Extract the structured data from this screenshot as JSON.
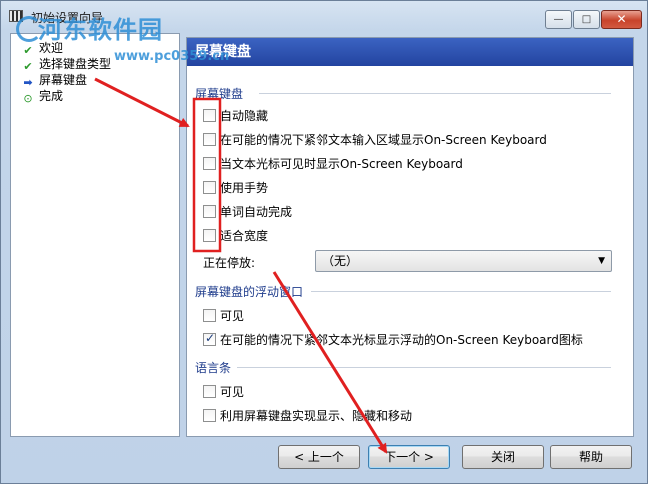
{
  "window": {
    "title": "初始设置向导",
    "controls": {
      "minimize": "—",
      "maximize": "□",
      "close": "✕"
    }
  },
  "watermark": {
    "brand": "河东软件园",
    "url": "www.pc0359.cn"
  },
  "nav": {
    "items": [
      {
        "label": "欢迎",
        "state": "done",
        "icon": "check-icon"
      },
      {
        "label": "选择键盘类型",
        "state": "done",
        "icon": "check-icon"
      },
      {
        "label": "屏幕键盘",
        "state": "current",
        "icon": "arrow-right-icon"
      },
      {
        "label": "完成",
        "state": "pending",
        "icon": "circle-icon"
      }
    ]
  },
  "page": {
    "header": "屏幕键盘",
    "groups": {
      "osk": {
        "label": "屏幕键盘",
        "options": [
          {
            "label": "自动隐藏",
            "checked": false
          },
          {
            "label": "在可能的情况下紧邻文本输入区域显示On-Screen Keyboard",
            "checked": false
          },
          {
            "label": "当文本光标可见时显示On-Screen Keyboard",
            "checked": false
          },
          {
            "label": "使用手势",
            "checked": false
          },
          {
            "label": "单词自动完成",
            "checked": false
          },
          {
            "label": "适合宽度",
            "checked": false
          }
        ],
        "docking_label": "正在停放:",
        "docking_value": "（无）"
      },
      "floating": {
        "label": "屏幕键盘的浮动窗口",
        "options": [
          {
            "label": "可见",
            "checked": false
          },
          {
            "label": "在可能的情况下紧邻文本光标显示浮动的On-Screen Keyboard图标",
            "checked": true
          }
        ]
      },
      "langbar": {
        "label": "语言条",
        "options": [
          {
            "label": "可见",
            "checked": false
          },
          {
            "label": "利用屏幕键盘实现显示、隐藏和移动",
            "checked": false
          }
        ]
      }
    }
  },
  "buttons": {
    "prev": "< 上一个",
    "next": "下一个 >",
    "close": "关闭",
    "help": "帮助"
  },
  "annotation_colors": {
    "arrow": "#e02020",
    "highlight_box": "#e02020"
  }
}
